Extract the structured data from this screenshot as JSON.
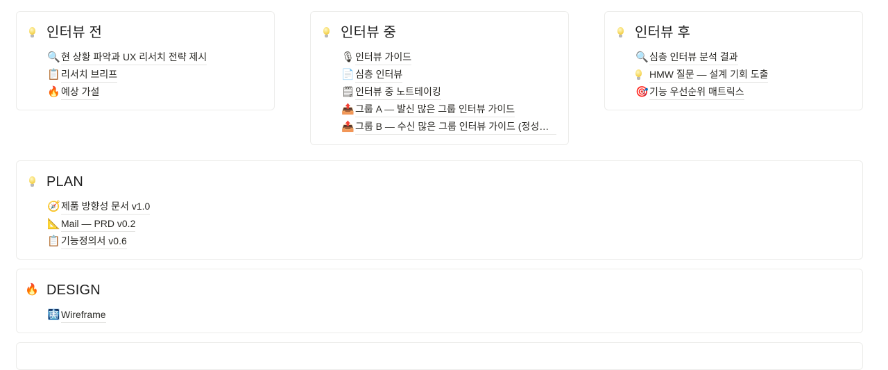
{
  "cards": {
    "before": {
      "icon": "lightbulb-icon",
      "title": "인터뷰 전",
      "items": [
        {
          "icon": "magnifier-icon",
          "glyph": "🔍",
          "label": "현 상황 파악과 UX 리서치 전략 제시"
        },
        {
          "icon": "clipboard-icon",
          "glyph": "📋",
          "label": "리서치 브리프"
        },
        {
          "icon": "fire-icon",
          "glyph": "🔥",
          "label": "예상 가설"
        }
      ]
    },
    "during": {
      "icon": "lightbulb-icon",
      "title": "인터뷰 중",
      "items": [
        {
          "icon": "microphone-icon",
          "glyph": "🎙",
          "label": "인터뷰 가이드"
        },
        {
          "icon": "page-icon",
          "glyph": "📄",
          "label": "심층 인터뷰"
        },
        {
          "icon": "notepad-icon",
          "glyph": "🗒",
          "label": "인터뷰 중 노트테이킹"
        },
        {
          "icon": "outbox-tray-icon",
          "glyph": "📤",
          "label": "그룹 A — 발신 많은 그룹 인터뷰 가이드"
        },
        {
          "icon": "outbox-tray-icon",
          "glyph": "📤",
          "label": "그룹 B — 수신 많은 그룹 인터뷰 가이드 (정성욱 대표…"
        }
      ]
    },
    "after": {
      "icon": "lightbulb-icon",
      "title": "인터뷰 후",
      "items": [
        {
          "icon": "magnifier-icon",
          "glyph": "🔍",
          "label": "심층 인터뷰 분석 결과"
        },
        {
          "icon": "lightbulb-icon",
          "glyph": "💡",
          "label": "HMW 질문 — 설계 기회 도출"
        },
        {
          "icon": "target-icon",
          "glyph": "🎯",
          "label": "기능 우선순위 매트릭스"
        }
      ]
    },
    "plan": {
      "icon": "lightbulb-icon",
      "title": "PLAN",
      "items": [
        {
          "icon": "compass-icon",
          "glyph": "🧭",
          "label": "제품 방향성 문서 v1.0"
        },
        {
          "icon": "triangular-ruler-icon",
          "glyph": "📐",
          "label": "Mail — PRD v0.2"
        },
        {
          "icon": "clipboard-icon",
          "glyph": "📋",
          "label": "기능정의서 v0.6"
        }
      ]
    },
    "design": {
      "icon": "fire-icon",
      "title": "DESIGN",
      "items": [
        {
          "icon": "xray-icon",
          "glyph": "🩻",
          "label": "Wireframe"
        }
      ]
    }
  }
}
